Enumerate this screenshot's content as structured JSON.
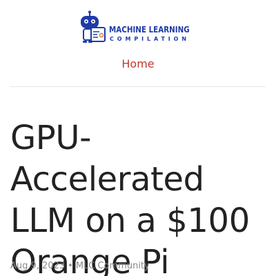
{
  "logo": {
    "title": "MACHINE LEARNING",
    "subtitle": "COMPILATION"
  },
  "nav": {
    "home": "Home"
  },
  "post": {
    "title": "GPU-Accelerated LLM on a $100 Orange Pi",
    "date": "Aug 9, 2023",
    "separator": "•",
    "author": "MLC Community"
  },
  "colors": {
    "brand": "#1f3ba8",
    "link": "#c0392b",
    "title_text": "#222222",
    "meta_text": "#8a8a8a"
  }
}
